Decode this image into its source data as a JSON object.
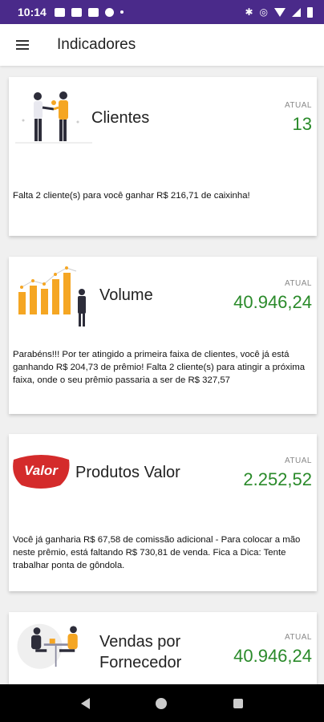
{
  "status_bar": {
    "time": "10:14"
  },
  "app_bar": {
    "title": "Indicadores"
  },
  "cards": [
    {
      "title": "Clientes",
      "atual_label": "ATUAL",
      "value": "13",
      "message": "Falta 2 cliente(s) para você ganhar R$ 216,71 de caixinha!"
    },
    {
      "title": "Volume",
      "atual_label": "ATUAL",
      "value": "40.946,24",
      "message": "Parabéns!!! Por ter atingido a primeira faixa de clientes, você já está ganhando R$ 204,73 de prêmio! Falta 2 cliente(s) para atingir a próxima faixa, onde o seu prêmio passaria a ser de R$ 327,57"
    },
    {
      "title": "Produtos Valor",
      "logo_text": "Valor",
      "atual_label": "ATUAL",
      "value": "2.252,52",
      "message": "Você já ganharia R$ 67,58 de comissão adicional - Para colocar a mão neste prêmio, está faltando R$ 730,81 de venda. Fica a Dica: Tente trabalhar ponta de gôndola."
    },
    {
      "title": "Vendas por Fornecedor",
      "atual_label": "ATUAL",
      "value": "40.946,24"
    }
  ],
  "colors": {
    "status_bar": "#4a2a8a",
    "value_green": "#2a8a2a",
    "valor_red": "#d42b2b",
    "accent_orange": "#f5a623"
  },
  "icons": [
    "menu-icon",
    "handshake-illustration",
    "growth-chart-illustration",
    "valor-logo",
    "meeting-illustration",
    "back-icon",
    "home-icon",
    "recents-icon"
  ]
}
